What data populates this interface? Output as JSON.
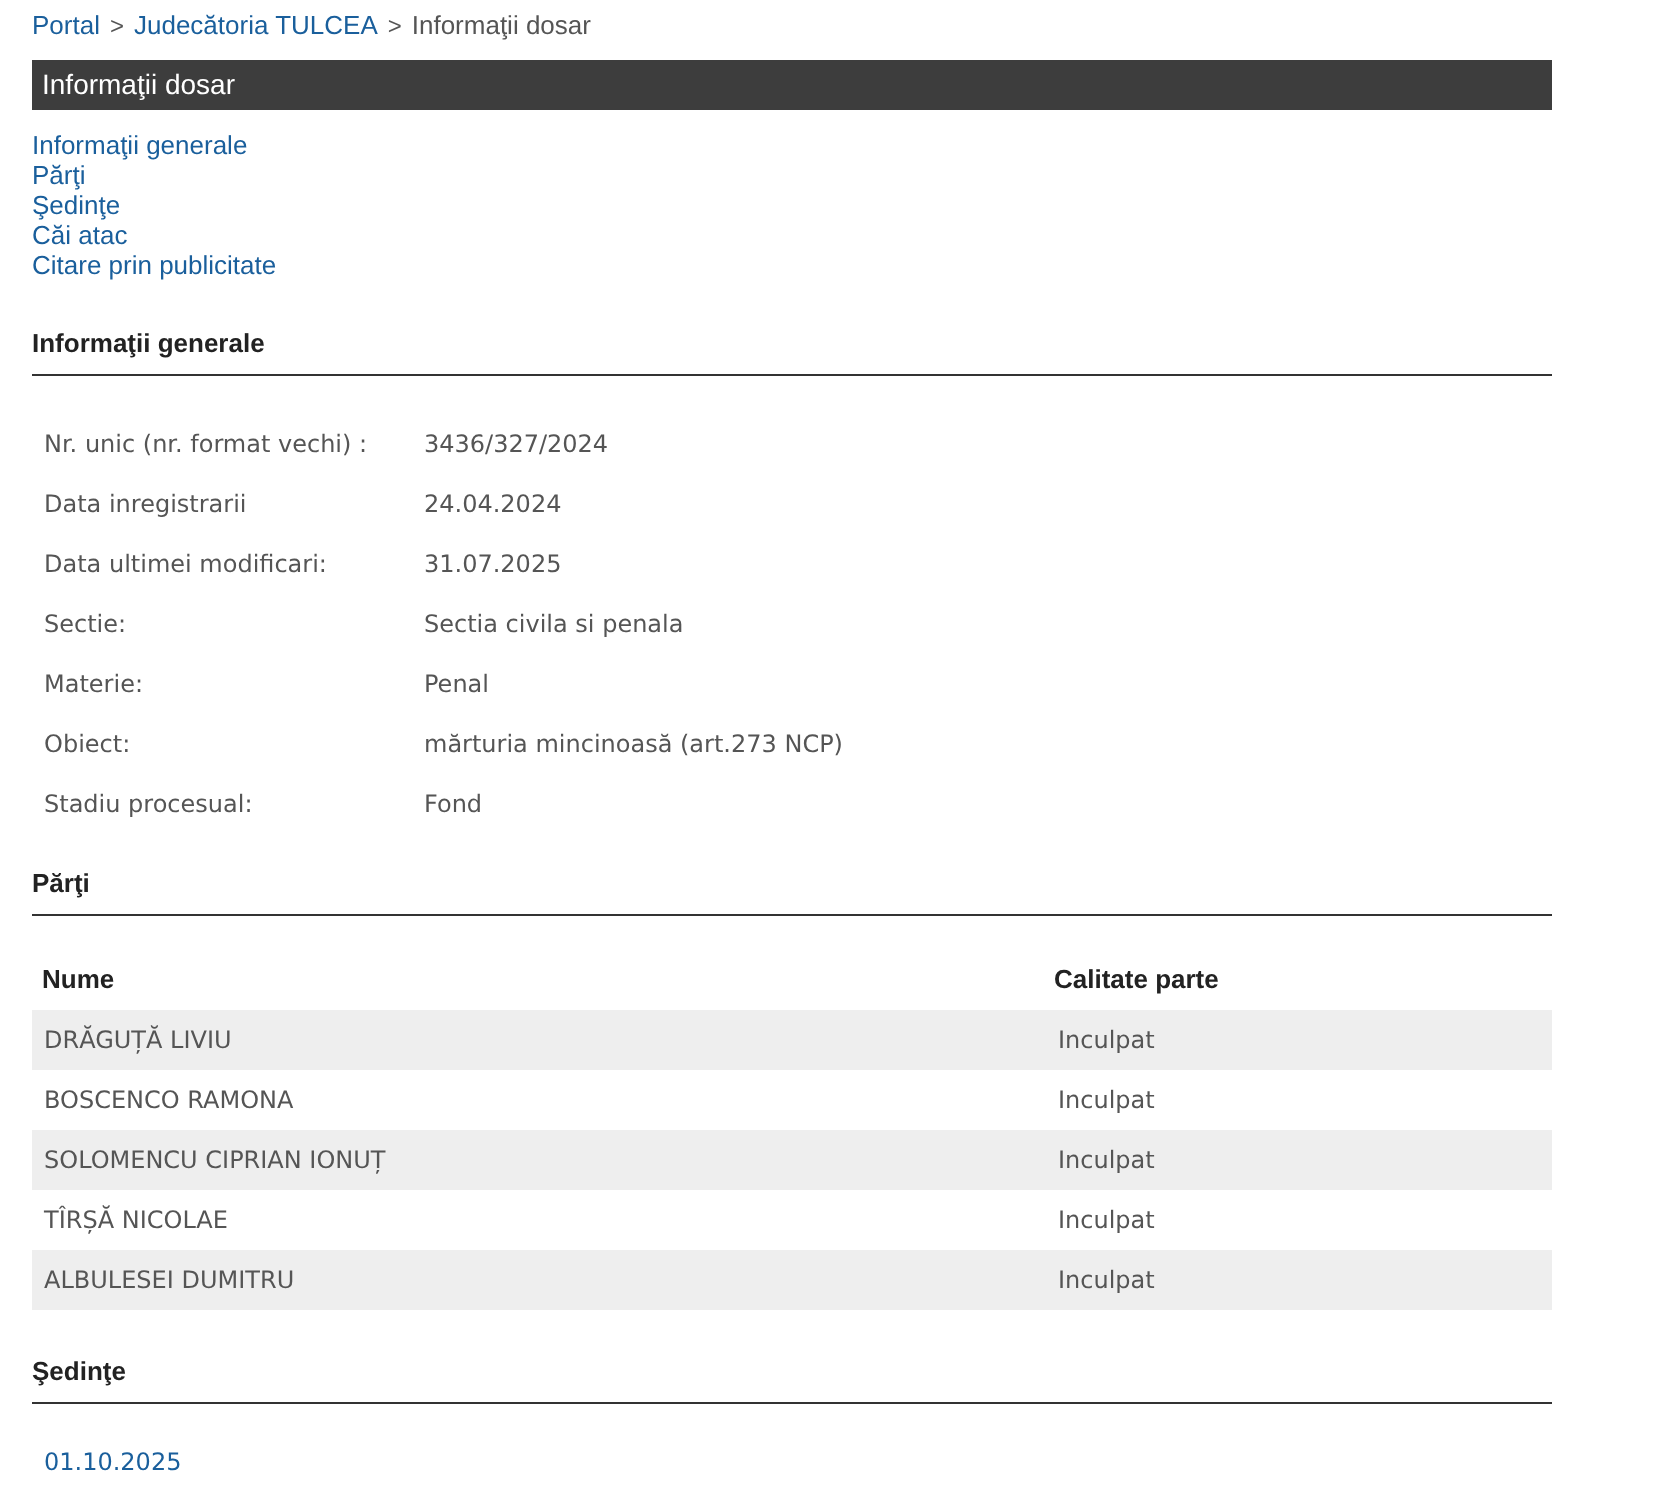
{
  "breadcrumb": [
    {
      "kind": "link",
      "label": "Portal"
    },
    {
      "kind": "separator",
      "label": ">"
    },
    {
      "kind": "link",
      "label": "Judecătoria TULCEA"
    },
    {
      "kind": "separator",
      "label": ">"
    },
    {
      "kind": "current",
      "label": "Informaţii dosar"
    }
  ],
  "title_bar": "Informaţii dosar",
  "nav_links": [
    "Informaţii generale",
    "Părţi",
    "Şedinţe",
    "Căi atac",
    "Citare prin publicitate"
  ],
  "general_info": {
    "heading": "Informaţii generale",
    "rows": [
      {
        "label": "Nr. unic (nr. format vechi) :",
        "value": "3436/327/2024"
      },
      {
        "label": "Data inregistrarii",
        "value": "24.04.2024"
      },
      {
        "label": "Data ultimei modificari:",
        "value": "31.07.2025"
      },
      {
        "label": "Sectie:",
        "value": "Sectia civila si penala"
      },
      {
        "label": "Materie:",
        "value": "Penal"
      },
      {
        "label": "Obiect:",
        "value": "mărturia mincinoasă (art.273 NCP)"
      },
      {
        "label": "Stadiu procesual:",
        "value": "Fond"
      }
    ]
  },
  "parties": {
    "heading": "Părţi",
    "columns": [
      "Nume",
      "Calitate parte"
    ],
    "rows": [
      {
        "name": "DRĂGUȚĂ LIVIU",
        "role": "Inculpat"
      },
      {
        "name": "BOSCENCO RAMONA",
        "role": "Inculpat"
      },
      {
        "name": "SOLOMENCU CIPRIAN IONUȚ",
        "role": "Inculpat"
      },
      {
        "name": "TÎRȘĂ NICOLAE",
        "role": "Inculpat"
      },
      {
        "name": "ALBULESEI DUMITRU",
        "role": "Inculpat"
      }
    ]
  },
  "hearings": {
    "heading": "Şedinţe",
    "dates": [
      "01.10.2025"
    ]
  }
}
